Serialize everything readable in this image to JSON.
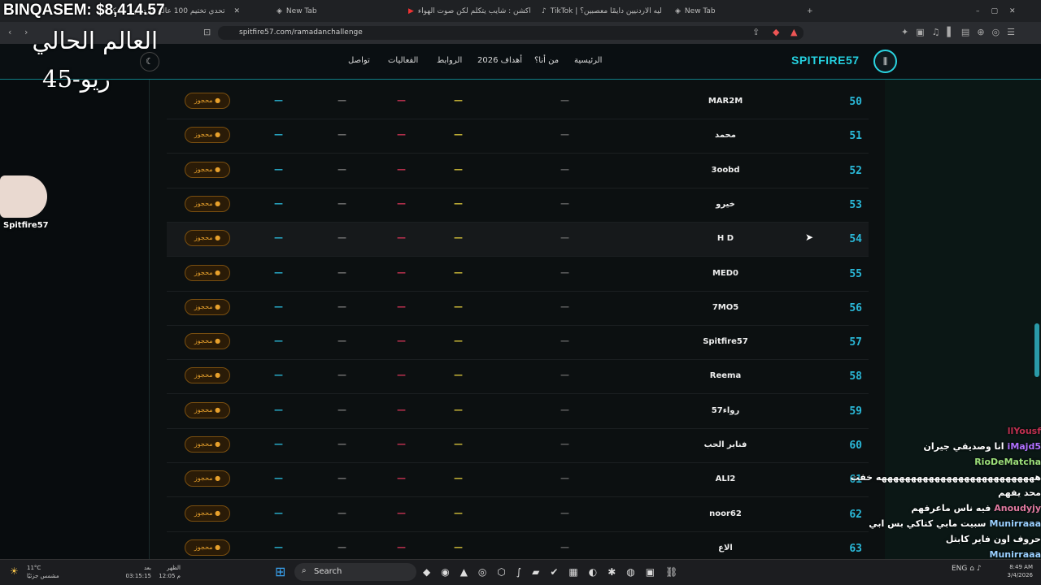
{
  "browser": {
    "tabs": [
      {
        "title": "تحدي تختيم 100 عالم هارد كور ماينكرافت"
      },
      {
        "title": "New Tab"
      },
      {
        "title": "رياكشن : شايب يتكلم لكن صوت الهواء"
      },
      {
        "title": "TikTok | ليه الاردنيين دايمًا معصبين؟"
      },
      {
        "title": "New Tab"
      }
    ],
    "url": "spitfire57.com/ramadanchallenge"
  },
  "site": {
    "logo": "SPITFIRE57",
    "menu": [
      "الرئيسية",
      "من أنا؟",
      "أهداف 2026",
      "الروابط",
      "الفعاليات",
      "تواصل"
    ]
  },
  "table": {
    "status_label": "● محجوز",
    "dash": "—",
    "rows": [
      {
        "rank": "50",
        "name": "MAR2M"
      },
      {
        "rank": "51",
        "name": "محمد"
      },
      {
        "rank": "52",
        "name": "3oobd"
      },
      {
        "rank": "53",
        "name": "خيرو"
      },
      {
        "rank": "54",
        "name": "H D"
      },
      {
        "rank": "55",
        "name": "MED0"
      },
      {
        "rank": "56",
        "name": "7MO5"
      },
      {
        "rank": "57",
        "name": "Spitfire57"
      },
      {
        "rank": "58",
        "name": "Reema"
      },
      {
        "rank": "59",
        "name": "رواء57"
      },
      {
        "rank": "60",
        "name": "فنابر الحب"
      },
      {
        "rank": "61",
        "name": "ALI2"
      },
      {
        "rank": "62",
        "name": "noor62"
      },
      {
        "rank": "63",
        "name": "الاع"
      }
    ]
  },
  "overlay": {
    "money": "BINQASEM: $8,414.57",
    "world_line1": "العالم الحالي",
    "world_line2": "ريو-45",
    "avatar_name": "Spitfire57"
  },
  "chat": [
    {
      "user": "llYousf",
      "text": "",
      "color": "#c03050"
    },
    {
      "user": "iMajd5",
      "text": "انا وصديقي جيران",
      "color": "#b070ff"
    },
    {
      "user": "RioDeMatcha",
      "text": "",
      "color": "#9de07a"
    },
    {
      "user": "",
      "text": "هههههههههههههههههههههههههههه خفت",
      "color": "#fff"
    },
    {
      "user": "",
      "text": "محد يفهم",
      "color": "#fff"
    },
    {
      "user": "Anoudyjy",
      "text": "فيه ناس ماعرفهم",
      "color": "#e07aa0"
    },
    {
      "user": "Munirraaa",
      "text": "سبيت مابي كتاكي بس ابي",
      "color": "#9ad0ff"
    },
    {
      "user": "",
      "text": "حروف اون فاير كابتل",
      "color": "#fff"
    },
    {
      "user": "Munirraaa",
      "text": "",
      "color": "#9ad0ff"
    }
  ],
  "taskbar": {
    "weather_temp": "11°C",
    "weather_desc": "مشمس جزئيًا",
    "prayer_label": "بعد",
    "prayer_time": "03:15:15",
    "prayer_name": "الظهر",
    "prayer_clock": "12:05 م",
    "search_label": "Search",
    "clock_time": "8:49 AM",
    "clock_date": "3/4/2026",
    "lang": "ENG"
  }
}
